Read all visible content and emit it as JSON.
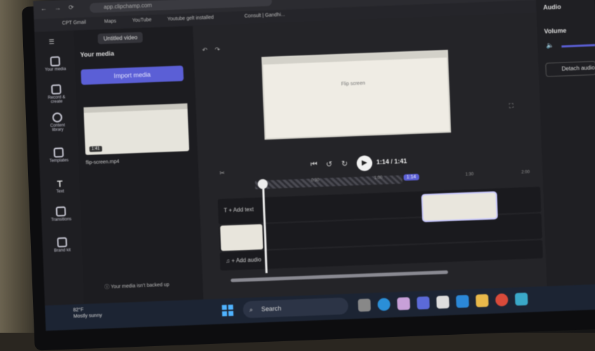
{
  "browser": {
    "url": "app.clipchamp.com",
    "bookmarks": [
      "CPT Gmail",
      "Maps",
      "YouTube",
      "Youtube gelt installed",
      "Consult | Gandhi..."
    ]
  },
  "sidebar": {
    "items": [
      {
        "label": "Your media",
        "icon": "media-icon"
      },
      {
        "label": "Record & create",
        "icon": "camera-icon"
      },
      {
        "label": "Content library",
        "icon": "library-icon"
      },
      {
        "label": "Templates",
        "icon": "templates-icon"
      },
      {
        "label": "Text",
        "icon": "text-icon"
      },
      {
        "label": "Transitions",
        "icon": "transitions-icon"
      },
      {
        "label": "Brand kit",
        "icon": "brand-icon"
      }
    ]
  },
  "project": {
    "title": "Untitled video"
  },
  "media": {
    "heading": "Your media",
    "import_label": "Import media",
    "clip_name": "flip-screen.mp4",
    "clip_duration": "1:41",
    "backup_text": "Your media isn't backed up"
  },
  "preview": {
    "text": "Flip screen"
  },
  "playback": {
    "time": "1:14 / 1:41",
    "position_badge": "1:14",
    "ruler_ticks": [
      "0:30",
      "1:00",
      "1:30",
      "2:00"
    ]
  },
  "timeline": {
    "add_text": "+ Add text",
    "add_audio": "+ Add audio"
  },
  "properties": {
    "audio_label": "Audio",
    "volume_label": "Volume",
    "detach_label": "Detach audio"
  },
  "taskbar": {
    "weather_temp": "82°F",
    "weather_desc": "Mostly sunny",
    "search_label": "Search"
  },
  "colors": {
    "accent": "#5b5fd6",
    "panel": "#1c1c20"
  }
}
